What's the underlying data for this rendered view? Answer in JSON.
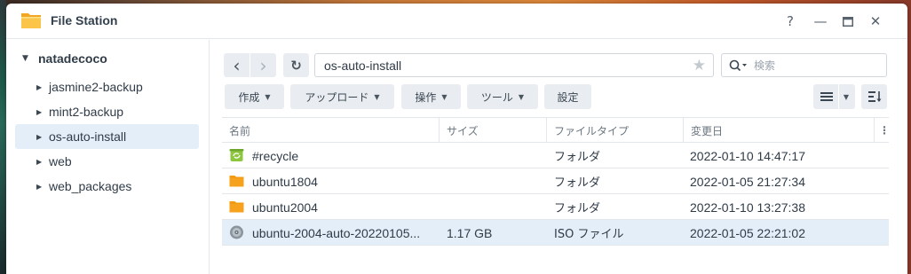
{
  "window": {
    "title": "File Station",
    "controls": {
      "help": "?",
      "minimize": "—",
      "maximize": "▭",
      "close": "✕"
    }
  },
  "sidebar": {
    "root": "natadecoco",
    "items": [
      {
        "label": "jasmine2-backup"
      },
      {
        "label": "mint2-backup"
      },
      {
        "label": "os-auto-install",
        "selected": true
      },
      {
        "label": "web"
      },
      {
        "label": "web_packages"
      }
    ]
  },
  "nav": {
    "back": "‹",
    "forward": "›",
    "refresh": "↻",
    "path": "os-auto-install",
    "search_placeholder": "検索"
  },
  "toolbar": {
    "create": "作成",
    "upload": "アップロード",
    "action": "操作",
    "tools": "ツール",
    "settings": "設定"
  },
  "table": {
    "columns": [
      "名前",
      "サイズ",
      "ファイルタイプ",
      "変更日"
    ],
    "rows": [
      {
        "name": "#recycle",
        "size": "",
        "type": "フォルダ",
        "modified": "2022-01-10 14:47:17",
        "icon": "recycle-folder-icon"
      },
      {
        "name": "ubuntu1804",
        "size": "",
        "type": "フォルダ",
        "modified": "2022-01-05 21:27:34",
        "icon": "folder-icon"
      },
      {
        "name": "ubuntu2004",
        "size": "",
        "type": "フォルダ",
        "modified": "2022-01-10 13:27:38",
        "icon": "folder-icon"
      },
      {
        "name": "ubuntu-2004-auto-20220105...",
        "size": "1.17 GB",
        "type": "ISO ファイル",
        "modified": "2022-01-05 22:21:02",
        "icon": "disc-image-icon",
        "selected": true
      }
    ]
  },
  "colors": {
    "accent": "#e3eef9",
    "folder": "#f6a21e",
    "recycle": "#8cc63f"
  }
}
